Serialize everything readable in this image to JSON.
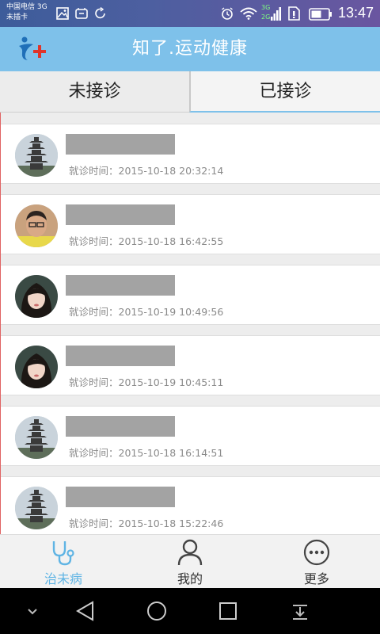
{
  "status_bar": {
    "carrier_line1": "中国电信 3G",
    "carrier_line2": "未插卡",
    "time": "13:47",
    "icons": [
      "image-icon",
      "sim-icon",
      "refresh-icon",
      "alarm-icon",
      "wifi-icon",
      "signal-icon",
      "sim-alert-icon",
      "battery-icon"
    ],
    "signal_labels": [
      "3G",
      "2G"
    ]
  },
  "header": {
    "title": "知了.运动健康",
    "logo_icon": "app-logo-icon",
    "color": "#7ec1ea"
  },
  "tabs": [
    {
      "label": "未接诊",
      "active": false
    },
    {
      "label": "已接诊",
      "active": true
    }
  ],
  "visit_prefix": "就诊时间：",
  "patients": [
    {
      "avatar": "pagoda",
      "visit_time": "2015-10-18 20:32:14"
    },
    {
      "avatar": "man",
      "visit_time": "2015-10-18 16:42:55"
    },
    {
      "avatar": "woman",
      "visit_time": "2015-10-19 10:49:56"
    },
    {
      "avatar": "woman",
      "visit_time": "2015-10-19 10:45:11"
    },
    {
      "avatar": "pagoda",
      "visit_time": "2015-10-18 16:14:51"
    },
    {
      "avatar": "pagoda",
      "visit_time": "2015-10-18 15:22:46"
    }
  ],
  "bottom_nav": [
    {
      "label": "治未病",
      "icon": "stethoscope-icon",
      "active": true
    },
    {
      "label": "我的",
      "icon": "person-icon",
      "active": false
    },
    {
      "label": "更多",
      "icon": "more-icon",
      "active": false
    }
  ],
  "system_nav": [
    "collapse-icon",
    "back-icon",
    "home-icon",
    "recents-icon",
    "notification-pull-icon"
  ],
  "colors": {
    "accent": "#7ec1ea",
    "active_nav": "#5fb4e4",
    "status_bar": "#4d5fa0"
  }
}
